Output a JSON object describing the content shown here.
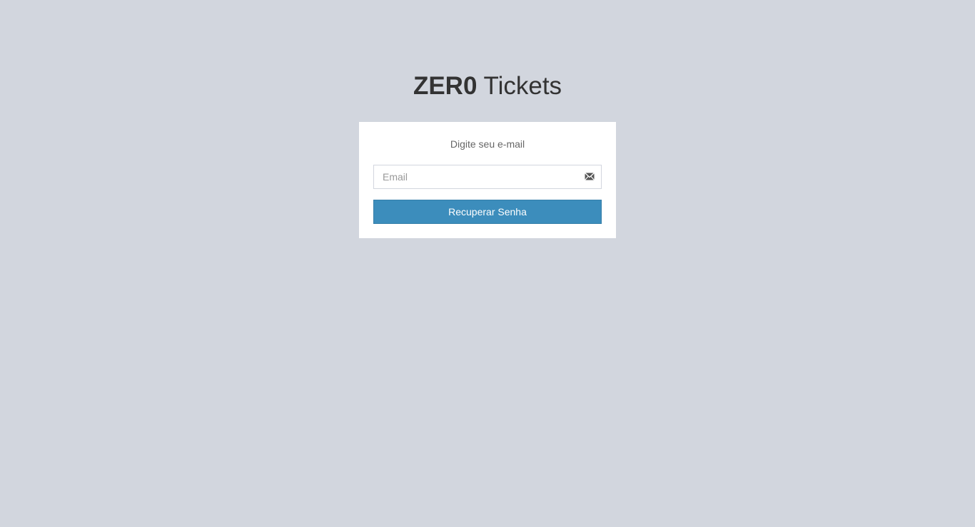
{
  "logo": {
    "bold": "ZER0",
    "light": "Tickets"
  },
  "form": {
    "message": "Digite seu e-mail",
    "email_placeholder": "Email",
    "email_value": "",
    "email_icon": "envelope-icon",
    "submit_label": "Recuperar Senha"
  },
  "colors": {
    "background": "#d2d6de",
    "box": "#ffffff",
    "primary_button": "#3c8dbc",
    "primary_button_border": "#367fa9",
    "logo_text": "#333333"
  }
}
